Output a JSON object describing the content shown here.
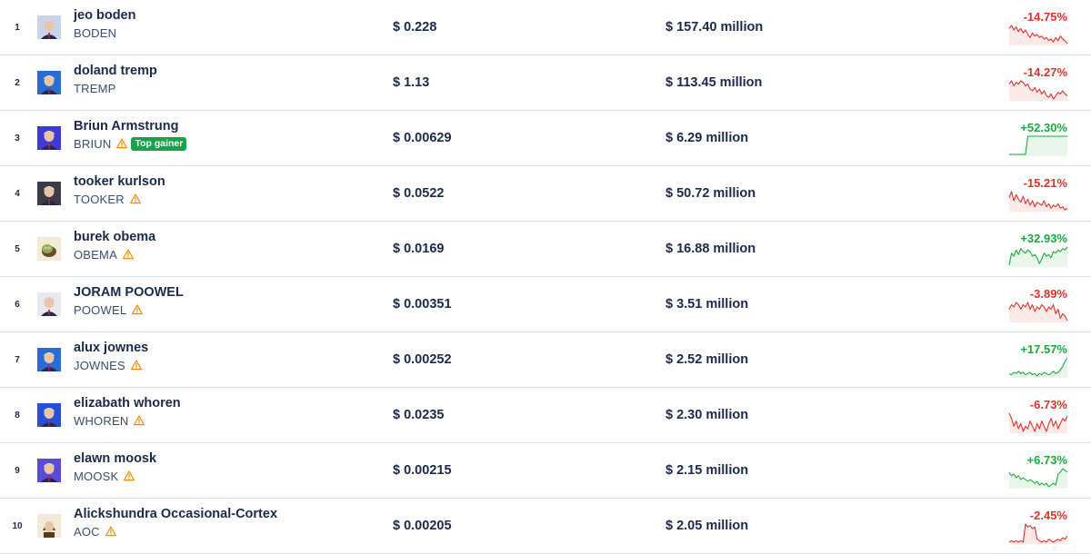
{
  "coins": [
    {
      "rank": "1",
      "name": "jeo boden",
      "symbol": "BODEN",
      "warning": false,
      "badge": "",
      "price": "$ 0.228",
      "market_cap": "$ 157.40 million",
      "change": "-14.75%",
      "direction": "down",
      "avatar_color": "#c8d4ec",
      "avatar_icon": "avatar-suit-man",
      "spark": [
        18,
        20,
        17,
        19,
        16,
        18,
        15,
        17,
        14,
        12,
        15,
        13,
        14,
        12,
        13,
        11,
        12,
        10,
        11,
        9,
        12,
        10,
        13,
        11,
        10,
        8
      ]
    },
    {
      "rank": "2",
      "name": "doland tremp",
      "symbol": "TREMP",
      "warning": false,
      "badge": "",
      "price": "$ 1.13",
      "market_cap": "$ 113.45 million",
      "change": "-14.27%",
      "direction": "down",
      "avatar_color": "#2a6bd6",
      "avatar_icon": "avatar-blue-portrait",
      "spark": [
        16,
        18,
        15,
        17,
        16,
        18,
        17,
        15,
        16,
        13,
        12,
        14,
        11,
        13,
        10,
        12,
        9,
        8,
        10,
        7,
        9,
        11,
        10,
        12,
        10,
        9
      ]
    },
    {
      "rank": "3",
      "name": "Briun Armstrung",
      "symbol": "BRIUN",
      "warning": true,
      "badge": "Top gainer",
      "price": "$ 0.00629",
      "market_cap": "$ 6.29 million",
      "change": "+52.30%",
      "direction": "up",
      "avatar_color": "#3d3ad8",
      "avatar_icon": "avatar-purple-portrait",
      "spark": [
        2,
        2,
        2,
        2,
        2,
        2,
        2,
        2,
        20,
        20,
        20,
        20,
        20,
        20,
        20,
        20,
        20,
        20,
        20,
        20,
        20,
        20,
        20,
        20,
        20,
        20
      ]
    },
    {
      "rank": "4",
      "name": "tooker kurlson",
      "symbol": "TOOKER",
      "warning": true,
      "badge": "",
      "price": "$ 0.0522",
      "market_cap": "$ 50.72 million",
      "change": "-15.21%",
      "direction": "down",
      "avatar_color": "#3a3a48",
      "avatar_icon": "avatar-dark-portrait",
      "spark": [
        14,
        18,
        12,
        16,
        13,
        11,
        15,
        10,
        13,
        9,
        12,
        8,
        11,
        10,
        9,
        12,
        8,
        10,
        7,
        9,
        8,
        10,
        7,
        8,
        6,
        7
      ]
    },
    {
      "rank": "5",
      "name": "burek obema",
      "symbol": "OBEMA",
      "warning": true,
      "badge": "",
      "price": "$ 0.0169",
      "market_cap": "$ 16.88 million",
      "change": "+32.93%",
      "direction": "up",
      "avatar_color": "#f3ead8",
      "avatar_icon": "avatar-pepe",
      "spark": [
        4,
        12,
        10,
        14,
        11,
        15,
        13,
        12,
        14,
        13,
        10,
        11,
        9,
        5,
        8,
        12,
        10,
        11,
        9,
        13,
        12,
        14,
        13,
        15,
        14,
        16
      ]
    },
    {
      "rank": "6",
      "name": "JORAM POOWEL",
      "symbol": "POOWEL",
      "warning": true,
      "badge": "",
      "price": "$ 0.00351",
      "market_cap": "$ 3.51 million",
      "change": "-3.89%",
      "direction": "down",
      "avatar_color": "#e8e8ee",
      "avatar_icon": "avatar-grey-portrait",
      "spark": [
        12,
        14,
        13,
        15,
        14,
        12,
        14,
        13,
        15,
        12,
        14,
        11,
        13,
        12,
        14,
        13,
        11,
        13,
        12,
        14,
        10,
        12,
        8,
        10,
        9,
        7
      ]
    },
    {
      "rank": "7",
      "name": "alux jownes",
      "symbol": "JOWNES",
      "warning": true,
      "badge": "",
      "price": "$ 0.00252",
      "market_cap": "$ 2.52 million",
      "change": "+17.57%",
      "direction": "up",
      "avatar_color": "#2a6bd6",
      "avatar_icon": "avatar-blue-portrait",
      "spark": [
        6,
        5,
        7,
        6,
        8,
        6,
        7,
        5,
        6,
        7,
        5,
        6,
        4,
        6,
        5,
        7,
        6,
        5,
        6,
        8,
        6,
        7,
        9,
        12,
        16,
        19
      ]
    },
    {
      "rank": "8",
      "name": "elizabath whoren",
      "symbol": "WHOREN",
      "warning": true,
      "badge": "",
      "price": "$ 0.0235",
      "market_cap": "$ 2.30 million",
      "change": "-6.73%",
      "direction": "down",
      "avatar_color": "#2a4fd6",
      "avatar_icon": "avatar-red-blue-portrait",
      "spark": [
        14,
        12,
        9,
        11,
        8,
        10,
        7,
        9,
        8,
        11,
        9,
        7,
        10,
        8,
        11,
        9,
        7,
        10,
        12,
        9,
        11,
        8,
        10,
        12,
        11,
        13
      ]
    },
    {
      "rank": "9",
      "name": "elawn moosk",
      "symbol": "MOOSK",
      "warning": true,
      "badge": "",
      "price": "$ 0.00215",
      "market_cap": "$ 2.15 million",
      "change": "+6.73%",
      "direction": "up",
      "avatar_color": "#5a4ad8",
      "avatar_icon": "avatar-purple-portrait",
      "spark": [
        12,
        10,
        11,
        9,
        10,
        8,
        9,
        8,
        7,
        8,
        7,
        6,
        7,
        5,
        6,
        5,
        6,
        4,
        5,
        6,
        5,
        11,
        12,
        14,
        13,
        12
      ]
    },
    {
      "rank": "10",
      "name": "Alickshundra Occasional-Cortex",
      "symbol": "AOC",
      "warning": true,
      "badge": "",
      "price": "$ 0.00205",
      "market_cap": "$ 2.05 million",
      "change": "-2.45%",
      "direction": "down",
      "avatar_color": "#f2ead6",
      "avatar_icon": "avatar-brown-hair",
      "spark": [
        2,
        3,
        2,
        3,
        2,
        3,
        2,
        14,
        12,
        13,
        11,
        12,
        4,
        3,
        2,
        3,
        2,
        4,
        3,
        2,
        3,
        4,
        3,
        5,
        4,
        6
      ]
    }
  ]
}
